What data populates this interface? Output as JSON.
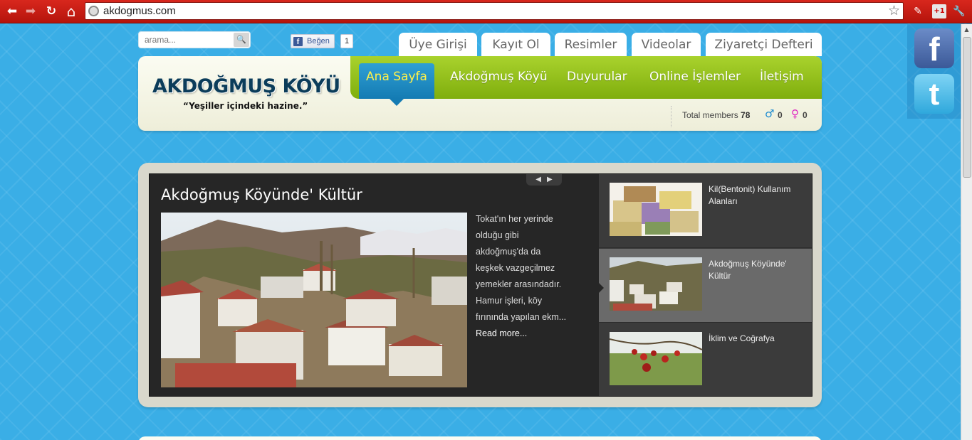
{
  "browser": {
    "url": "akdogmus.com",
    "back_glyph": "⬅",
    "forward_glyph": "➡",
    "reload_glyph": "↻",
    "home_glyph": "⌂",
    "star_glyph": "☆",
    "ext_gplus": "+1",
    "ext_wrench": "🔧"
  },
  "search": {
    "placeholder": "arama...",
    "button_glyph": "🔍"
  },
  "like": {
    "label": "Beğen",
    "count": "1",
    "fb_glyph": "f"
  },
  "top_tabs": [
    {
      "label": "Üye Girişi"
    },
    {
      "label": "Kayıt Ol"
    },
    {
      "label": "Resimler"
    },
    {
      "label": "Videolar"
    },
    {
      "label": "Ziyaretçi Defteri"
    }
  ],
  "header": {
    "logo_title": "AKDOĞMUŞ KÖYÜ",
    "logo_subtitle": "“Yeşiller içindeki hazine.”"
  },
  "main_nav": [
    {
      "label": "Ana Sayfa",
      "active": true
    },
    {
      "label": "Akdoğmuş Köyü"
    },
    {
      "label": "Duyurular"
    },
    {
      "label": "Online İşlemler"
    },
    {
      "label": "İletişim"
    }
  ],
  "members": {
    "label": "Total members",
    "total": "78",
    "male_count": "0",
    "female_count": "0",
    "male_glyph": "♂",
    "female_glyph": "♀"
  },
  "social": {
    "facebook_glyph": "f",
    "twitter_glyph": "t"
  },
  "slider": {
    "prev_glyph": "◀",
    "next_glyph": "▶",
    "title": "Akdoğmuş Köyünde' Kültür",
    "excerpt": "Tokat'ın her yerinde olduğu gibi akdoğmuş'da da keşkek vazgeçilmez yemekler arasındadır. Hamur işleri, köy fırınında yapılan ekm... ",
    "read_more": "Read more...",
    "items": [
      {
        "label": "Kil(Bentonit) Kullanım Alanları"
      },
      {
        "label": "Akdoğmuş Köyünde' Kültür",
        "active": true
      },
      {
        "label": "İklim ve Coğrafya"
      }
    ]
  },
  "colors": {
    "page_bg": "#3aaee6",
    "nav_green": "#8fbf17",
    "nav_active_blue": "#1a88c2",
    "nav_active_text": "#fff14a",
    "chrome_red": "#c41a12"
  }
}
